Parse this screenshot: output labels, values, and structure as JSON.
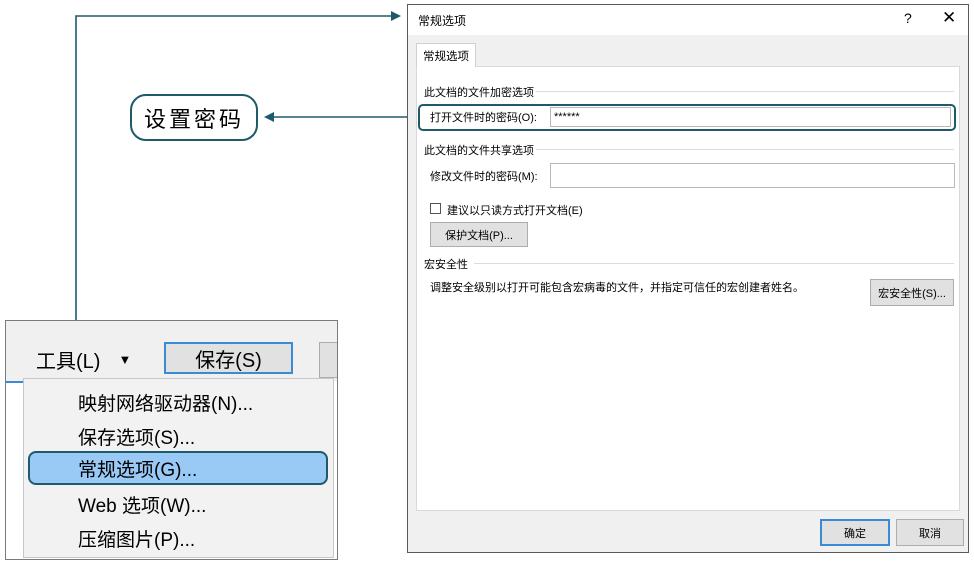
{
  "left_panel": {
    "tools_label": "工具(L)",
    "tools_caret": "▼",
    "save_label": "保存(S)",
    "menu_items": [
      "映射网络驱动器(N)...",
      "保存选项(S)...",
      "常规选项(G)...",
      "Web 选项(W)...",
      "压缩图片(P)..."
    ],
    "selected_index": 2
  },
  "callout": {
    "text": "设置密码"
  },
  "dialog": {
    "title": "常规选项",
    "help": "?",
    "close": "✕",
    "tab": "常规选项",
    "encryption_section": "此文档的文件加密选项",
    "open_password_label": "打开文件时的密码(O):",
    "open_password_value": "******",
    "sharing_section": "此文档的文件共享选项",
    "modify_password_label": "修改文件时的密码(M):",
    "modify_password_value": "",
    "readonly_label": "建议以只读方式打开文档(E)",
    "readonly_checked": false,
    "protect_button": "保护文档(P)...",
    "macro_section": "宏安全性",
    "macro_description": "调整安全级别以打开可能包含宏病毒的文件，并指定可信任的宏创建者姓名。",
    "macro_button": "宏安全性(S)...",
    "ok_button": "确定",
    "cancel_button": "取消"
  },
  "colors": {
    "accent_teal": "#1e5a6a",
    "selection_blue": "#99c9f5",
    "focus_blue": "#3c8ad6"
  }
}
